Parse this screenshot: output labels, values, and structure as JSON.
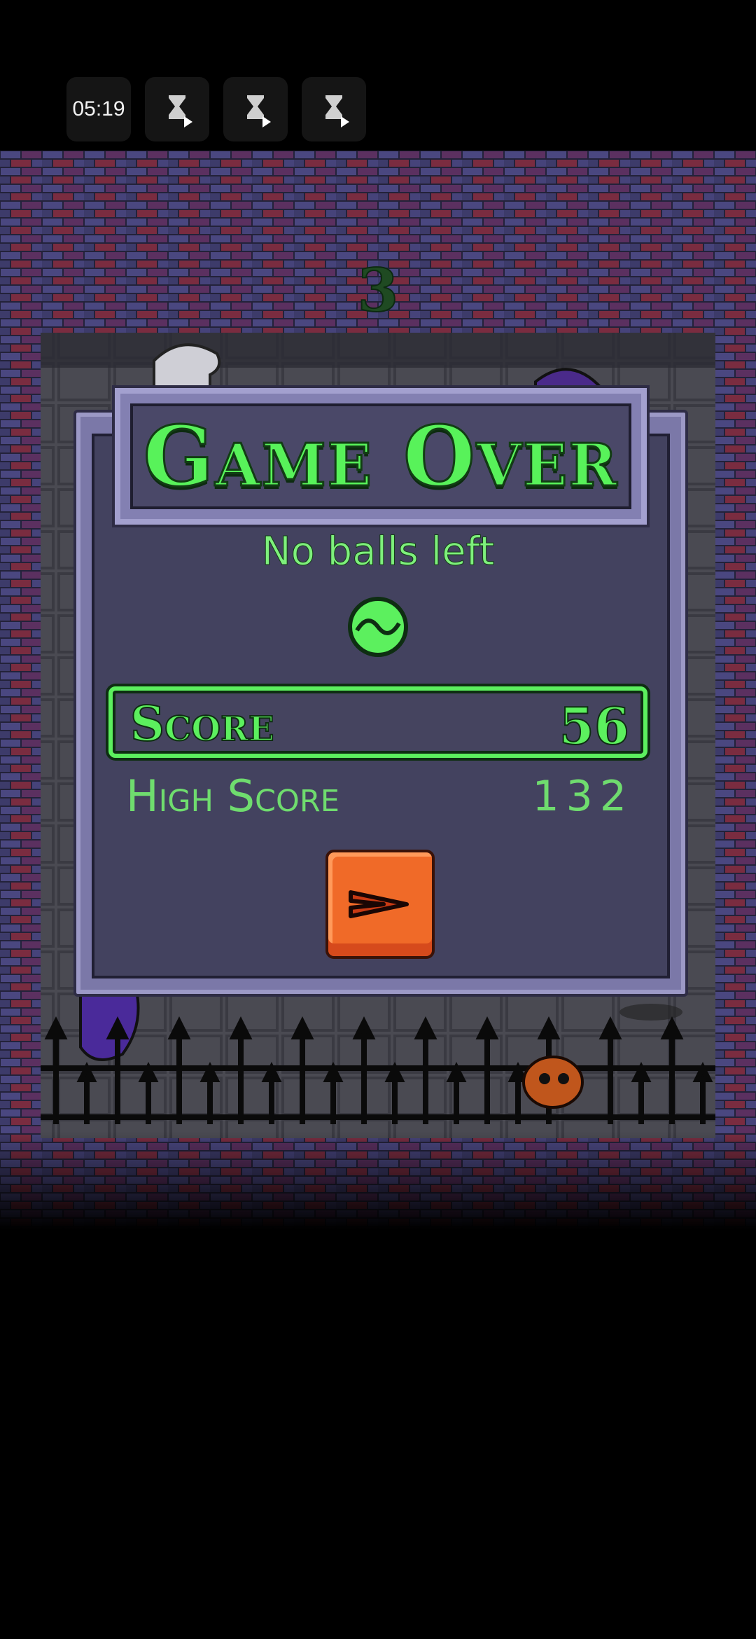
{
  "status_bar": {
    "time": "05:19",
    "icons": [
      "hourglass-play-icon",
      "hourglass-play-icon",
      "hourglass-play-icon"
    ]
  },
  "game": {
    "round_number": "3"
  },
  "dialog": {
    "title": "Game Over",
    "subtitle": "No balls left",
    "score_label": "Score",
    "score_value": "56",
    "high_score_label": "High Score",
    "high_score_value": "132",
    "next_button_icon": "chevron-right-icon"
  },
  "colors": {
    "accent_green": "#5cf05e",
    "panel": "#43425f",
    "button_orange": "#f06a28"
  }
}
